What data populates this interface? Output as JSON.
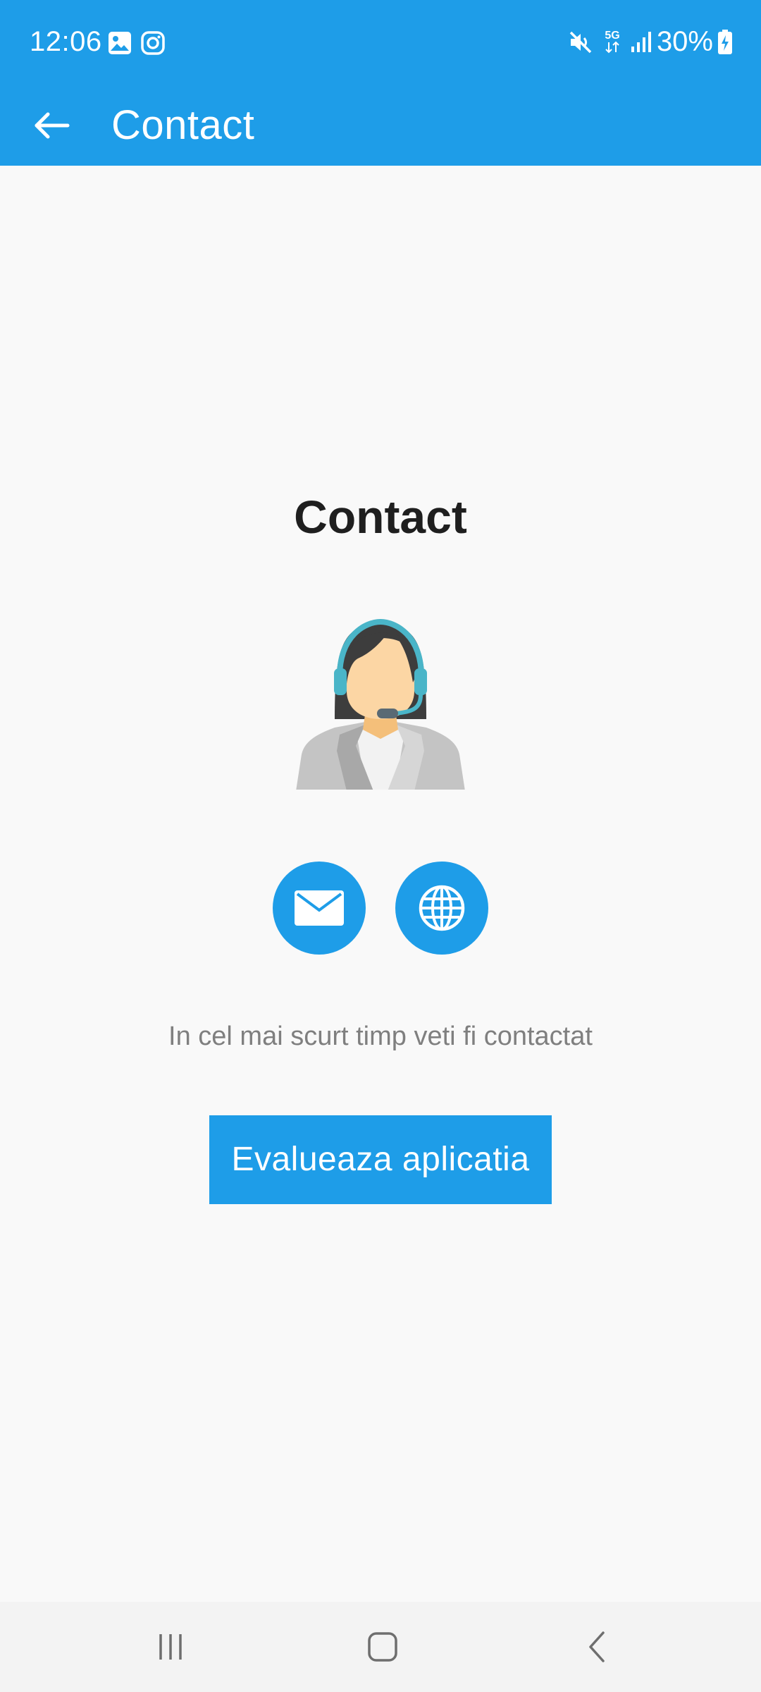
{
  "status_bar": {
    "time": "12:06",
    "battery": "30%",
    "network": "5G",
    "icons": [
      "gallery-icon",
      "instagram-icon",
      "mute-icon",
      "5g-icon",
      "signal-icon",
      "battery-charging-icon"
    ]
  },
  "toolbar": {
    "title": "Contact",
    "back_icon": "arrow-left-icon"
  },
  "content": {
    "title": "Contact",
    "avatar_icon": "support-agent-icon",
    "actions": [
      {
        "name": "email-button",
        "icon": "envelope-icon"
      },
      {
        "name": "website-button",
        "icon": "globe-icon"
      }
    ],
    "info": "In cel mai scurt timp veti fi contactat",
    "rate_button": "Evalueaza aplicatia"
  },
  "nav_bar": {
    "buttons": [
      "recents-icon",
      "home-icon",
      "back-icon"
    ]
  },
  "colors": {
    "primary": "#1e9de8",
    "background": "#f9f9f9",
    "text_dark": "#1f1f1f",
    "text_muted": "#7f7f7f",
    "nav_background": "#f3f3f3"
  }
}
